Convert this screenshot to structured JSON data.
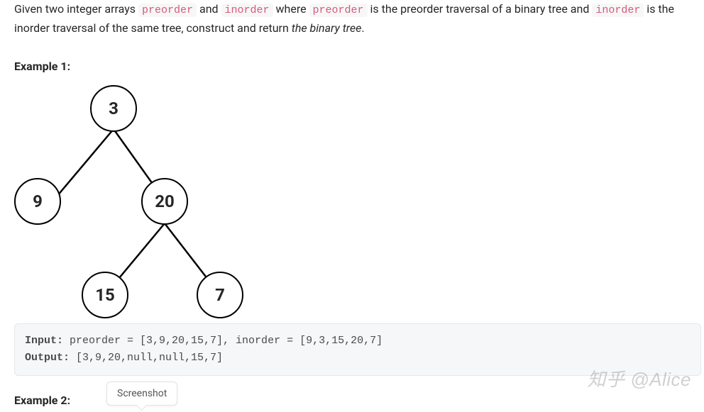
{
  "description": {
    "t1": "Given two integer arrays ",
    "c1": "preorder",
    "t2": " and ",
    "c2": "inorder",
    "t3": " where ",
    "c3": "preorder",
    "t4": " is the preorder traversal of a binary tree and ",
    "c4": "inorder",
    "t5": " is the inorder traversal of the same tree, construct and return ",
    "em": "the binary tree",
    "t6": "."
  },
  "example1_label": "Example 1:",
  "example2_label": "Example 2:",
  "tree": {
    "n3": "3",
    "n9": "9",
    "n20": "20",
    "n15": "15",
    "n7": "7"
  },
  "codeblock": {
    "input_label": "Input:",
    "input_rest": " preorder = [3,9,20,15,7], inorder = [9,3,15,20,7]",
    "output_label": "Output:",
    "output_rest": " [3,9,20,null,null,15,7]"
  },
  "tooltip": "Screenshot",
  "watermark": "知乎 @Alice"
}
